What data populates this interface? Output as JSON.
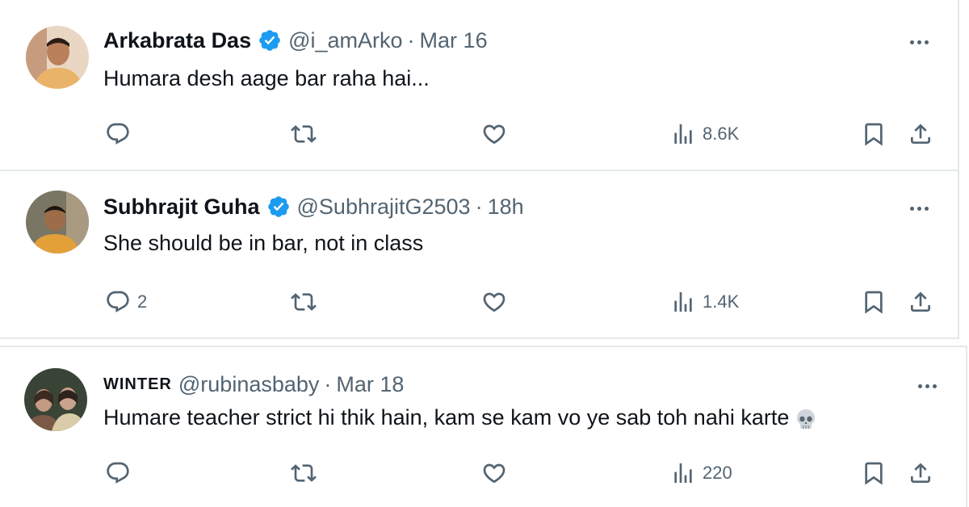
{
  "tweets": [
    {
      "name": "Arkabrata Das",
      "verified": true,
      "handle": "@i_amArko",
      "separator": "·",
      "time": "Mar 16",
      "text": "Humara desh aage bar raha hai...",
      "reply_count": "",
      "views": "8.6K",
      "avatar_colors": {
        "bg": "#d9a47a",
        "face": "#c98a5f",
        "shirt": "#e8b868"
      }
    },
    {
      "name": "Subhrajit Guha",
      "verified": true,
      "handle": "@SubhrajitG2503",
      "separator": "·",
      "time": "18h",
      "text": "She should be in bar, not in class",
      "reply_count": "2",
      "views": "1.4K",
      "avatar_colors": {
        "bg": "#6b6a5c",
        "face": "#a77a55",
        "shirt": "#e0a040"
      }
    },
    {
      "name": "WINTER",
      "verified": false,
      "handle": "@rubinasbaby",
      "separator": "·",
      "time": "Mar 18",
      "text": "Humare teacher strict hi thik hain, kam se kam vo ye sab toh nahi karte",
      "emoji": "skull-icon",
      "reply_count": "",
      "views": "220",
      "avatar_colors": {
        "bg": "#3d4a3a",
        "face": "#c8a08a",
        "shirt": "#d8c8a8"
      }
    }
  ],
  "colors": {
    "text": "#0f1419",
    "secondary": "#536471",
    "verified": "#1d9bf0",
    "divider": "#e3e8ec"
  },
  "icons": [
    "reply-icon",
    "retweet-icon",
    "like-icon",
    "views-icon",
    "bookmark-icon",
    "share-icon",
    "more-icon",
    "verified-icon"
  ]
}
